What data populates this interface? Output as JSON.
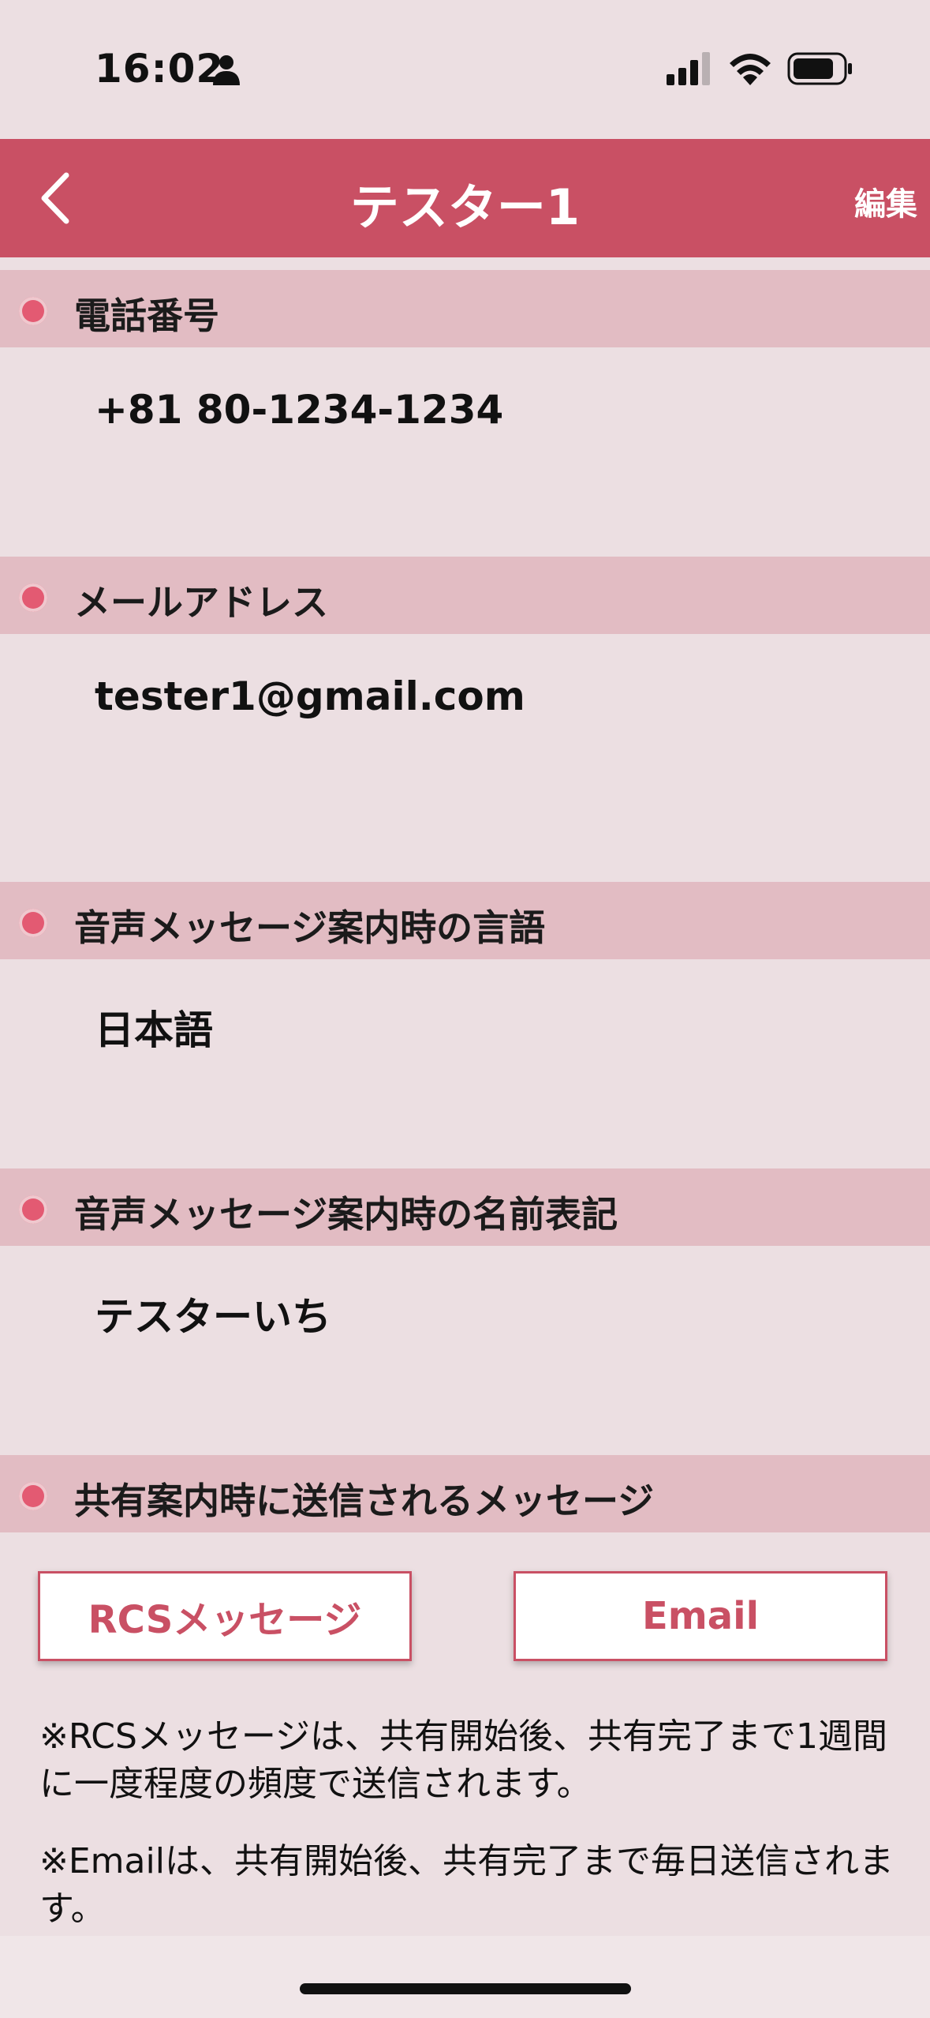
{
  "status_bar": {
    "time": "16:02"
  },
  "nav": {
    "title": "テスター1",
    "edit_label": "編集"
  },
  "sections": [
    {
      "label": "電話番号",
      "value": "+81 80-1234-1234"
    },
    {
      "label": "メールアドレス",
      "value": "tester1@gmail.com"
    },
    {
      "label": "音声メッセージ案内時の言語",
      "value": "日本語"
    },
    {
      "label": "音声メッセージ案内時の名前表記",
      "value": "テスターいち"
    },
    {
      "label": "共有案内時に送信されるメッセージ"
    }
  ],
  "buttons": {
    "rcs_label": "RCSメッセージ",
    "email_label": "Email"
  },
  "notes": {
    "rcs": "※RCSメッセージは、共有開始後、共有完了まで1週間に一度程度の頻度で送信されます。",
    "email": "※Emailは、共有開始後、共有完了まで毎日送信されます。"
  },
  "colors": {
    "accent": "#c95064",
    "header_bg": "#e2bcc3",
    "background": "#ecdfe2"
  }
}
